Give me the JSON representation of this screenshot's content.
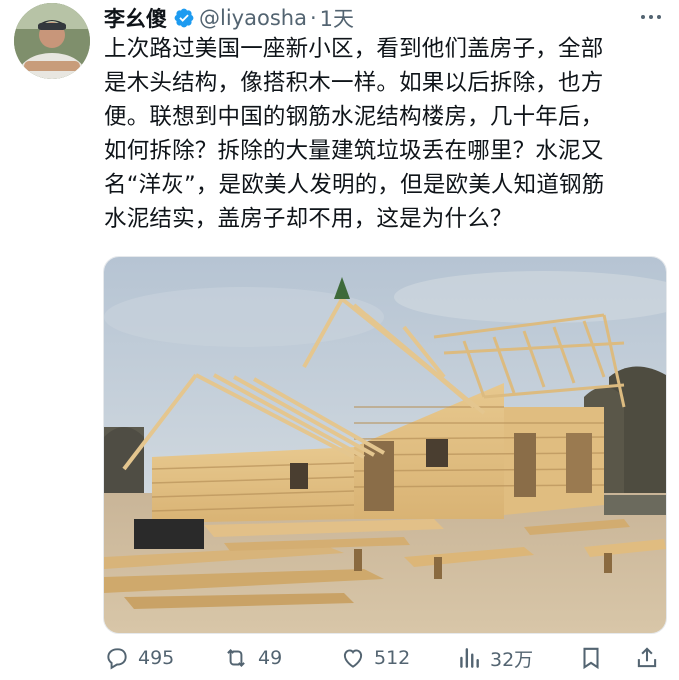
{
  "user": {
    "display_name": "李幺傻",
    "handle": "@liyaosha",
    "separator": "·",
    "time": "1天",
    "verified_color": "#1d9bf0"
  },
  "tweet": {
    "text": "上次路过美国一座新小区，看到他们盖房子，全部\n是木头结构，像搭积木一样。如果以后拆除，也方\n便。联想到中国的钢筋水泥结构楼房，几十年后，\n如何拆除？拆除的大量建筑垃圾丢在哪里？水泥又\n名“洋灰”，是欧美人发明的，但是欧美人知道钢筋\n水泥结实，盖房子却不用，这是为什么？"
  },
  "media": {
    "subject": "wooden-house-under-construction"
  },
  "actions": {
    "replies": "495",
    "retweets": "49",
    "likes": "512",
    "views": "32万"
  },
  "icons": {
    "more": "more-icon",
    "reply": "reply-icon",
    "retweet": "retweet-icon",
    "like": "heart-icon",
    "views": "views-icon",
    "bookmark": "bookmark-icon",
    "share": "share-icon"
  }
}
